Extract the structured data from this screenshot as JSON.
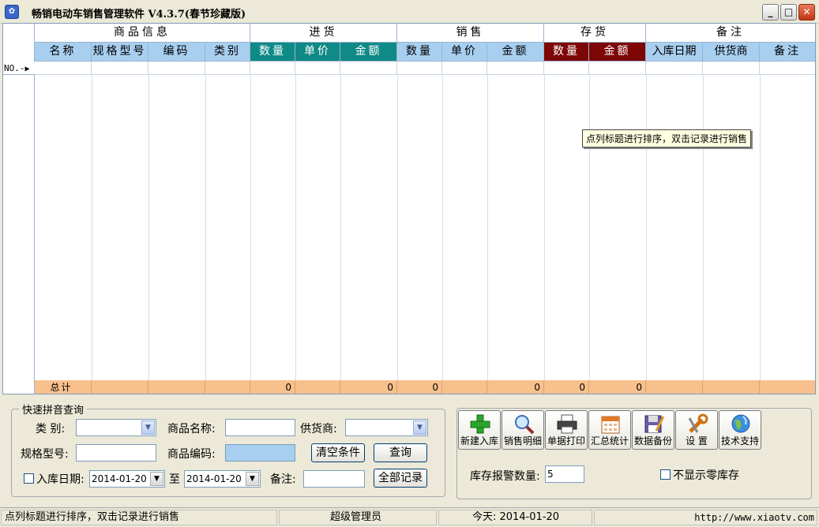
{
  "window": {
    "title": "畅销电动车销售管理软件  V4.3.7(春节珍藏版)"
  },
  "grid": {
    "group_headers": [
      "商品信息",
      "进货",
      "销售",
      "存货",
      "备注"
    ],
    "columns": [
      "名称",
      "规格型号",
      "编码",
      "类别",
      "数量",
      "单价",
      "金额",
      "数量",
      "单价",
      "金额",
      "数量",
      "金额",
      "入库日期",
      "供货商",
      "备注"
    ],
    "new_row_label": "NO.-",
    "totals": {
      "label": "总计",
      "purchase_qty": "0",
      "purchase_amount": "0",
      "sales_qty": "0",
      "sales_amount": "0",
      "stock_qty": "0",
      "stock_amount": "0"
    },
    "header_colors": {
      "light": "#a8cff0",
      "teal": "#0f8a86",
      "maroon": "#7d0606",
      "totals": "#f8c08d"
    }
  },
  "tooltip": "点列标题进行排序，双击记录进行销售",
  "query": {
    "legend": "快速拼音查询",
    "category_label": "类 别:",
    "category_value": "",
    "name_label": "商品名称:",
    "name_value": "",
    "supplier_label": "供货商:",
    "supplier_value": "",
    "model_label": "规格型号:",
    "model_value": "",
    "code_label": "商品编码:",
    "code_value": "",
    "clear_button": "清空条件",
    "search_button": "查询",
    "date_label": "入库日期:",
    "date_from": "2014-01-20",
    "to_label": "至",
    "date_to": "2014-01-20",
    "remark_label": "备注:",
    "remark_value": "",
    "all_button": "全部记录"
  },
  "toolbar": {
    "buttons": [
      {
        "label": "新建入库",
        "icon": "add-icon"
      },
      {
        "label": "销售明细",
        "icon": "magnifier-icon"
      },
      {
        "label": "单据打印",
        "icon": "printer-icon"
      },
      {
        "label": "汇总统计",
        "icon": "calendar-icon"
      },
      {
        "label": "数据备份",
        "icon": "floppy-disk-icon"
      },
      {
        "label": "设 置",
        "icon": "wrench-icon"
      },
      {
        "label": "技术支持",
        "icon": "globe-icon"
      }
    ],
    "stock_alert_label": "库存报警数量:",
    "stock_alert_value": "5",
    "hide_zero_label": "不显示零库存"
  },
  "status": {
    "hint": "点列标题进行排序，双击记录进行销售",
    "user": "超级管理员",
    "today": "今天: 2014-01-20",
    "url": "http://www.xiaotv.com"
  }
}
